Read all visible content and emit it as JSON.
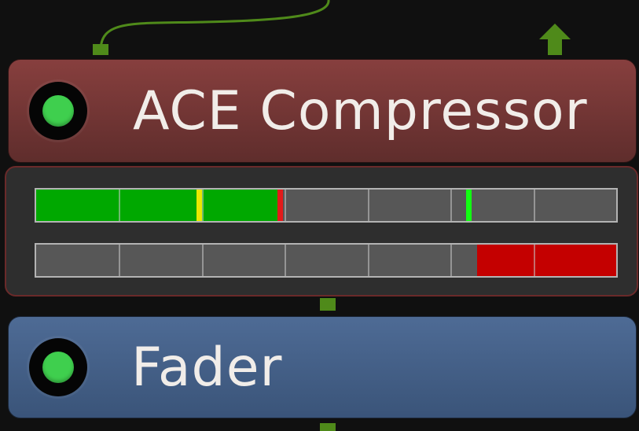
{
  "plugins": [
    {
      "name": "ACE Compressor",
      "active": true,
      "color": "#7a3836",
      "led_color": "#3fcf4e"
    },
    {
      "name": "Fader",
      "active": true,
      "color": "#4a6590",
      "led_color": "#3fcf4e"
    }
  ],
  "meters": {
    "tick_count": 7,
    "input_level": {
      "fill_fraction": 0.425,
      "fill_color": "#00a800",
      "marker_color": "#e8e800",
      "marker_fraction": 0.28,
      "clip_color": "#e21a1a",
      "peak_color": "#12ff12",
      "peak_fraction": 0.745
    },
    "gain_reduction": {
      "fill_fraction": 0.24,
      "fill_color": "#c40000",
      "direction": "right-to-left"
    }
  },
  "connections": {
    "wire_color": "#4f8a1a",
    "port_color": "#4f8a1a"
  }
}
